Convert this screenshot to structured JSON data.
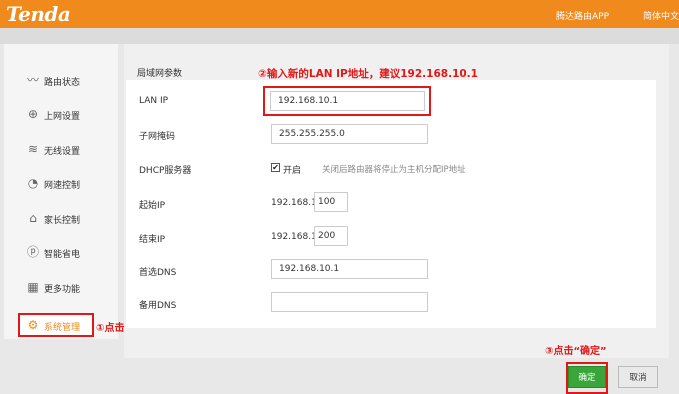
{
  "header": {
    "logo": "Tenda",
    "app_link": "腾达路由APP",
    "language": "简体中文"
  },
  "sidebar": {
    "items": [
      {
        "label": "路由状态",
        "icon": "status-wave-icon",
        "glyph": "〰"
      },
      {
        "label": "上网设置",
        "icon": "globe-icon",
        "glyph": "⊕"
      },
      {
        "label": "无线设置",
        "icon": "wifi-icon",
        "glyph": "≋"
      },
      {
        "label": "网速控制",
        "icon": "speed-gauge-icon",
        "glyph": "◔"
      },
      {
        "label": "家长控制",
        "icon": "house-icon",
        "glyph": "⌂"
      },
      {
        "label": "智能省电",
        "icon": "power-saving-icon",
        "glyph": "ⓟ"
      },
      {
        "label": "更多功能",
        "icon": "grid-icon",
        "glyph": "▦"
      },
      {
        "label": "系统管理",
        "icon": "gear-icon",
        "glyph": "⚙"
      }
    ],
    "active_index": 7
  },
  "annotations": {
    "step1": "①点击",
    "step2": "②输入新的LAN IP地址，建议192.168.10.1",
    "step3": "③点击“确定”"
  },
  "main": {
    "section_title": "局域网参数",
    "lan_ip": {
      "label": "LAN IP",
      "value": "192.168.10.1"
    },
    "subnet_mask": {
      "label": "子网掩码",
      "value": "255.255.255.0"
    },
    "dhcp": {
      "label": "DHCP服务器",
      "checked": true,
      "check_mark": "✔",
      "state_label": "开启",
      "hint": "关闭后路由器将停止为主机分配IP地址"
    },
    "start_ip": {
      "label": "起始IP",
      "prefix": "192.168.10.",
      "value": "100"
    },
    "end_ip": {
      "label": "结束IP",
      "prefix": "192.168.10.",
      "value": "200"
    },
    "primary_dns": {
      "label": "首选DNS",
      "value": "192.168.10.1"
    },
    "secondary_dns": {
      "label": "备用DNS",
      "value": ""
    }
  },
  "buttons": {
    "confirm": "确定",
    "cancel": "取消"
  },
  "colors": {
    "brand_orange": "#f08a1c",
    "annotation_red": "#e01818",
    "confirm_green": "#3aa63a"
  }
}
